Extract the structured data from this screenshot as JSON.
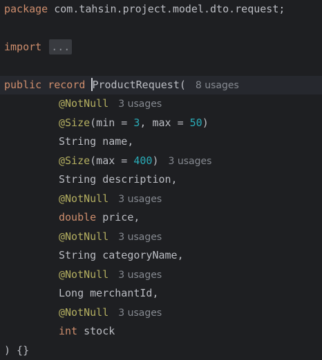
{
  "code": {
    "package_kw": "package",
    "package_name": " com.tahsin.project.model.dto.request;",
    "import_kw": "import",
    "import_fold": "...",
    "public_kw": "public",
    "record_kw": "record",
    "record_name": "ProductRequest(",
    "record_usages": "8 usages",
    "notnull": "@NotNull",
    "size_ann": "@Size",
    "size1_open": "(min = ",
    "size1_min": "3",
    "size1_mid": ", max = ",
    "size1_max": "50",
    "close_paren": ")",
    "field_name": "String name,",
    "size2_open": "(max = ",
    "size2_max": "400",
    "size2_usages": "3 usages",
    "field_description": "String description,",
    "double_kw": "double",
    "field_price": " price,",
    "field_category": "String categoryName,",
    "field_merchant": "Long merchantId,",
    "int_kw": "int",
    "field_stock": " stock",
    "usages_3": "3 usages",
    "closing": ") {}"
  }
}
